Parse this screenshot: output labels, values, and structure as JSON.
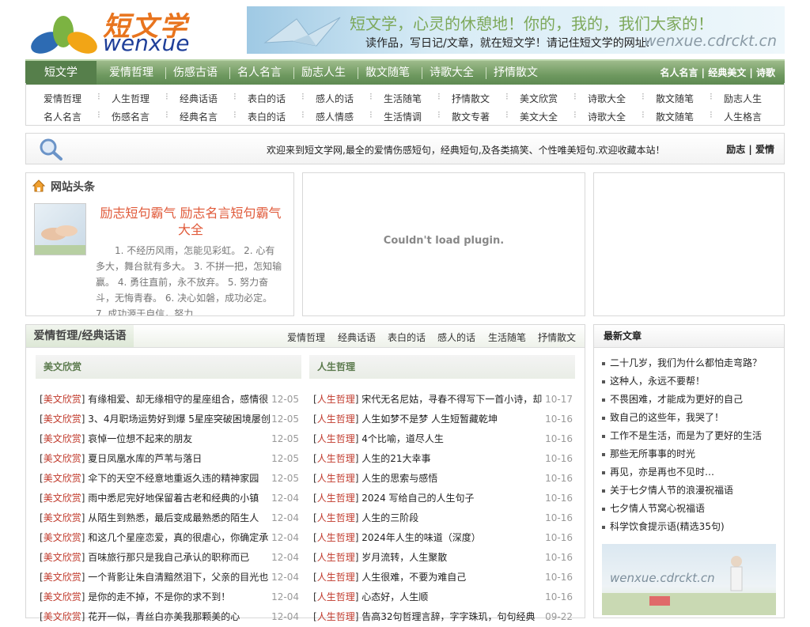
{
  "logo": {
    "cn": "短文学",
    "en": "wenxue"
  },
  "banner": {
    "line1": "短文学，心灵的休憩地！你的，我的，我们大家的！",
    "line2": "读作品，写日记/文章，就在短文学！请记住短文学的网址:",
    "url": "wenxue.cdrckt.cn"
  },
  "nav": {
    "home": "短文学",
    "items": [
      "爱情哲理",
      "伤感古语",
      "名人名言",
      "励志人生",
      "散文随笔",
      "诗歌大全",
      "抒情散文"
    ],
    "right": [
      "名人名言",
      "经典美文",
      "诗歌"
    ]
  },
  "subnav": {
    "row1": [
      "爱情哲理",
      "人生哲理",
      "经典话语",
      "表白的话",
      "感人的话",
      "生活随笔",
      "抒情散文",
      "美文欣赏",
      "诗歌大全",
      "散文随笔",
      "励志人生"
    ],
    "row2": [
      "名人名言",
      "伤感名言",
      "经典名言",
      "表白的话",
      "感人情感",
      "生活情调",
      "散文专著",
      "美文大全",
      "诗歌大全",
      "散文随笔",
      "人生格言"
    ]
  },
  "bar": {
    "welcome": "欢迎来到短文学网,最全的爱情伤感短句，经典短句,及各类搞笑、个性唯美短句.欢迎收藏本站！",
    "tags": [
      "励志",
      "爱情"
    ]
  },
  "headline": {
    "title": "网站头条",
    "article_title": "励志短句霸气 励志名言短句霸气大全",
    "article_text": "1. 不经历风雨，怎能见彩虹。 2. 心有多大，舞台就有多大。 3. 不拼一把，怎知输赢。 4. 勇往直前，永不放弃。 5. 努力奋斗，无悔青春。 6. 决心如磐，成功必定。 7. 成功源于自信，努力..."
  },
  "plugin": {
    "message": "Couldn't load plugin."
  },
  "section": {
    "title": "爱情哲理/经典话语",
    "links": [
      "爱情哲理",
      "经典话语",
      "表白的话",
      "感人的话",
      "生活随笔",
      "抒情散文"
    ]
  },
  "left_col": {
    "header": "美文欣赏",
    "rows": [
      {
        "cat": "美文欣赏",
        "title": "有缘相爱、却无缘相守的星座组合，感情很",
        "date": "12-05"
      },
      {
        "cat": "美文欣赏",
        "title": "3、4月职场运势好到爆 5星座突破困境屡创",
        "date": "12-05"
      },
      {
        "cat": "美文欣赏",
        "title": "哀悼一位想不起来的朋友",
        "date": "12-05"
      },
      {
        "cat": "美文欣赏",
        "title": "夏日凤凰水库的芦苇与落日",
        "date": "12-05"
      },
      {
        "cat": "美文欣赏",
        "title": "伞下的天空不经意地重返久违的精神家园",
        "date": "12-05"
      },
      {
        "cat": "美文欣赏",
        "title": "雨中悉尼完好地保留着古老和经典的小镇",
        "date": "12-04"
      },
      {
        "cat": "美文欣赏",
        "title": "从陌生到熟悉，最后变成最熟悉的陌生人",
        "date": "12-04"
      },
      {
        "cat": "美文欣赏",
        "title": "和这几个星座恋爱，真的很虐心，你确定承",
        "date": "12-04"
      },
      {
        "cat": "美文欣赏",
        "title": "百味旅行那只是我自己承认的职称而已",
        "date": "12-04"
      },
      {
        "cat": "美文欣赏",
        "title": "一个背影让朱自清黯然泪下，父亲的目光也",
        "date": "12-04"
      },
      {
        "cat": "美文欣赏",
        "title": "是你的走不掉，不是你的求不到！",
        "date": "12-04"
      },
      {
        "cat": "美文欣赏",
        "title": "花开一似，青丝白亦美我那颗美的心",
        "date": "12-04"
      }
    ]
  },
  "right_col": {
    "header": "人生哲理",
    "rows": [
      {
        "cat": "人生哲理",
        "title": "宋代无名尼姑，寻春不得写下一首小诗，却",
        "date": "10-17"
      },
      {
        "cat": "人生哲理",
        "title": "人生如梦不是梦 人生短暂藏乾坤",
        "date": "10-16"
      },
      {
        "cat": "人生哲理",
        "title": "4个比喻，道尽人生",
        "date": "10-16"
      },
      {
        "cat": "人生哲理",
        "title": "人生的21大幸事",
        "date": "10-16"
      },
      {
        "cat": "人生哲理",
        "title": "人生的思索与感悟",
        "date": "10-16"
      },
      {
        "cat": "人生哲理",
        "title": "2024 写给自己的人生句子",
        "date": "10-16"
      },
      {
        "cat": "人生哲理",
        "title": "人生的三阶段",
        "date": "10-16"
      },
      {
        "cat": "人生哲理",
        "title": "2024年人生的味道（深度）",
        "date": "10-16"
      },
      {
        "cat": "人生哲理",
        "title": "岁月流转，人生聚散",
        "date": "10-16"
      },
      {
        "cat": "人生哲理",
        "title": "人生很难，不要为难自己",
        "date": "10-16"
      },
      {
        "cat": "人生哲理",
        "title": "心态好，人生顺",
        "date": "10-16"
      },
      {
        "cat": "人生哲理",
        "title": "告高32句哲理言辞，字字珠玑，句句经典",
        "date": "09-22"
      }
    ]
  },
  "latest": {
    "title": "最新文章",
    "items": [
      "二十几岁，我们为什么都怕走弯路？",
      "这种人，永远不要帮！",
      "不畏困难，才能成为更好的自己",
      "致自己的这些年，我哭了！",
      "工作不是生活，而是为了更好的生活",
      "那些无所事事的时光",
      "再见，亦是再也不见时…",
      "关于七夕情人节的浪漫祝福语",
      "七夕情人节窝心祝福语",
      "科学饮食提示语(精选35句)"
    ],
    "image_caption": "wenxue.cdrckt.cn"
  },
  "colors": {
    "nav_green": "#6f9960",
    "accent_red": "#c0392b",
    "title_red": "#e05a3a"
  }
}
